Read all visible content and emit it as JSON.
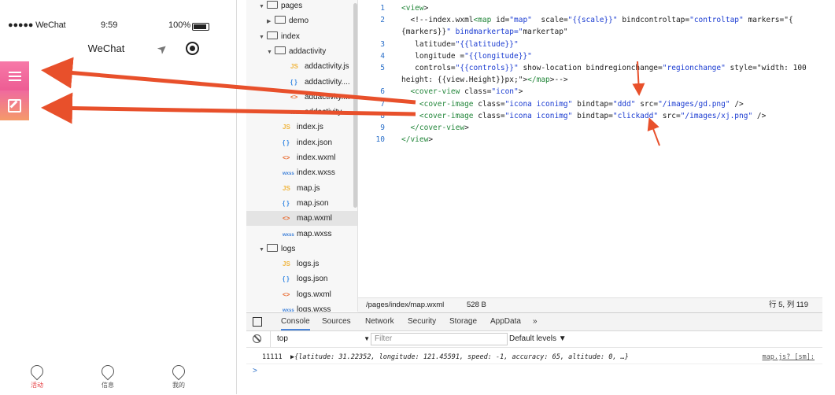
{
  "phone": {
    "carrier": "●●●●● WeChat",
    "time": "9:59",
    "battery": "100%",
    "nav_title": "WeChat",
    "tabs": [
      {
        "label": "活动"
      },
      {
        "label": "信息"
      },
      {
        "label": "我的"
      }
    ]
  },
  "tree": {
    "rows": [
      {
        "caret": "▼",
        "type": "folder",
        "name": "pages"
      },
      {
        "caret": "▶",
        "type": "folder",
        "name": "demo"
      },
      {
        "caret": "▼",
        "type": "folder",
        "name": "index"
      },
      {
        "caret": "▼",
        "type": "folder",
        "name": "addactivity"
      },
      {
        "caret": "",
        "type": "js",
        "name": "addactivity.js"
      },
      {
        "caret": "",
        "type": "json",
        "name": "addactivity...."
      },
      {
        "caret": "",
        "type": "wxml",
        "name": "addactivity...."
      },
      {
        "caret": "",
        "type": "wxss",
        "name": "addactivity...."
      },
      {
        "caret": "",
        "type": "js",
        "name": "index.js"
      },
      {
        "caret": "",
        "type": "json",
        "name": "index.json"
      },
      {
        "caret": "",
        "type": "wxml",
        "name": "index.wxml"
      },
      {
        "caret": "",
        "type": "wxss",
        "name": "index.wxss"
      },
      {
        "caret": "",
        "type": "js",
        "name": "map.js"
      },
      {
        "caret": "",
        "type": "json",
        "name": "map.json"
      },
      {
        "caret": "",
        "type": "wxml",
        "name": "map.wxml",
        "selected": true
      },
      {
        "caret": "",
        "type": "wxss",
        "name": "map.wxss"
      },
      {
        "caret": "▼",
        "type": "folder",
        "name": "logs"
      },
      {
        "caret": "",
        "type": "js",
        "name": "logs.js"
      },
      {
        "caret": "",
        "type": "json",
        "name": "logs.json"
      },
      {
        "caret": "",
        "type": "wxml",
        "name": "logs.wxml"
      },
      {
        "caret": "",
        "type": "wxss",
        "name": "logs.wxss"
      }
    ],
    "icon_glyphs": {
      "js": "JS",
      "json": "{ }",
      "wxml": "<>",
      "wxss": "wxss"
    }
  },
  "editor": {
    "lines": [
      {
        "n": "1",
        "text": "<view>"
      },
      {
        "n": "2",
        "text": "  <!--index.wxml<map id=\"map\"  scale=\"{{scale}}\" bindcontroltap=\"controltap\" markers=\"{"
      },
      {
        "n": "",
        "text": "{markers}}\" bindmarkertap=\"markertap\""
      },
      {
        "n": "3",
        "text": "   latitude=\"{{latitude}}\""
      },
      {
        "n": "4",
        "text": "   longitude =\"{{longitude}}\""
      },
      {
        "n": "5",
        "text": "   controls=\"{{controls}}\" show-location bindregionchange=\"regionchange\" style=\"width: 100"
      },
      {
        "n": "",
        "text": "height: {{view.Height}}px;\"></map>-->"
      },
      {
        "n": "6",
        "text": "  <cover-view class=\"icon\">"
      },
      {
        "n": "7",
        "text": "    <cover-image class=\"icona iconimg\" bindtap=\"ddd\" src=\"/images/gd.png\" />"
      },
      {
        "n": "8",
        "text": "    <cover-image class=\"icona iconimg\" bindtap=\"clickadd\" src=\"/images/xj.png\" />"
      },
      {
        "n": "9",
        "text": "  </cover-view>"
      },
      {
        "n": "10",
        "text": "</view>"
      }
    ],
    "path": "/pages/index/map.wxml",
    "size": "528 B",
    "cursor": "行 5, 列 119"
  },
  "devtools": {
    "tabs": [
      "Console",
      "Sources",
      "Network",
      "Security",
      "Storage",
      "AppData",
      "»"
    ],
    "active_tab": "Console",
    "context": "top",
    "filter_placeholder": "Filter",
    "levels": "Default levels ▼",
    "log": {
      "count": "11111",
      "object": "▶{latitude: 31.22352, longitude: 121.45591, speed: -1, accuracy: 65, altitude: 0, …}",
      "source": "map.js? [sm]:"
    },
    "prompt": ">"
  },
  "colors": {
    "annotation_arrow": "#e8502b",
    "side_button": "#f06a9b",
    "active_tab": "#e4393c"
  }
}
